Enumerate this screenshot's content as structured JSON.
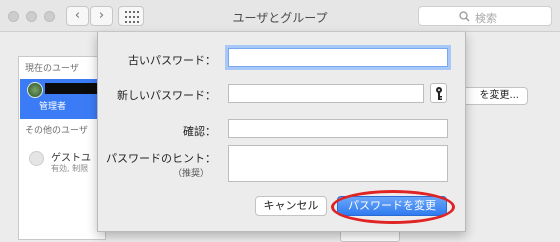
{
  "window": {
    "title": "ユーザとグループ",
    "search_placeholder": "検索",
    "back_glyph": "‹",
    "forward_glyph": "›"
  },
  "user_list": {
    "current_header": "現在のユーザ",
    "current_user_role": "管理者",
    "other_header": "その他のユーザ",
    "guest_name": "ゲストユ",
    "guest_status": "有効, 制限"
  },
  "background": {
    "change_password_button": "を変更..."
  },
  "dialog": {
    "old_password_label": "古いパスワード：",
    "new_password_label": "新しいパスワード：",
    "verify_label": "確認：",
    "hint_label": "パスワードのヒント：",
    "hint_sub_label": "（推奨）",
    "old_password_value": "",
    "new_password_value": "",
    "verify_value": "",
    "hint_value": "",
    "cancel_button": "キャンセル",
    "confirm_button": "パスワードを変更"
  },
  "colors": {
    "accent": "#3b7cf6",
    "highlight_ring": "#e02424",
    "focus_glow": "#a8c8f7"
  },
  "icons": [
    "search-icon",
    "grid-icon",
    "key-icon",
    "back-icon",
    "forward-icon",
    "avatar",
    "guest-avatar"
  ]
}
